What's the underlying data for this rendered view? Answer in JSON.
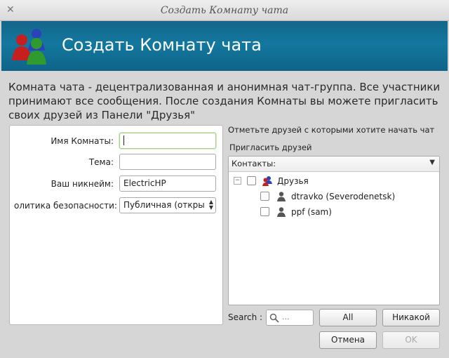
{
  "window": {
    "title": "Создать Комнату чата",
    "close_glyph": "✕"
  },
  "banner": {
    "title": "Создать Комнату чата",
    "icon": "users-group-icon"
  },
  "description": "Комната чата - децентрализованная и анонимная чат-группа. Все участники принимают все сообщения. После создания Комнаты вы можете пригласить своих друзей из Панели \"Друзья\"",
  "form": {
    "room_name_label": "Имя Комнаты:",
    "room_name_value": "",
    "topic_label": "Тема:",
    "topic_value": "",
    "nickname_label": "Ваш никнейм:",
    "nickname_value": "ElectricHP",
    "security_label": "олитика безопасности:",
    "security_value": "Публичная (откры"
  },
  "friends": {
    "hint": "Отметьте друзей с которыми хотите начать чат",
    "invite_label": "Пригласить друзей",
    "header": "Контакты:",
    "group": {
      "name": "Друзья",
      "expander": "−",
      "checked": false
    },
    "items": [
      {
        "name": "dtravko (Severodenetsk)",
        "checked": false
      },
      {
        "name": "ppf (sam)",
        "checked": false
      }
    ]
  },
  "search": {
    "label": "Search :",
    "placeholder": "..."
  },
  "buttons": {
    "all": "All",
    "none": "Никакой",
    "cancel": "Отмена",
    "ok": "OK"
  },
  "colors": {
    "banner": "#13789f",
    "focus_border": "#a6cf8d"
  }
}
